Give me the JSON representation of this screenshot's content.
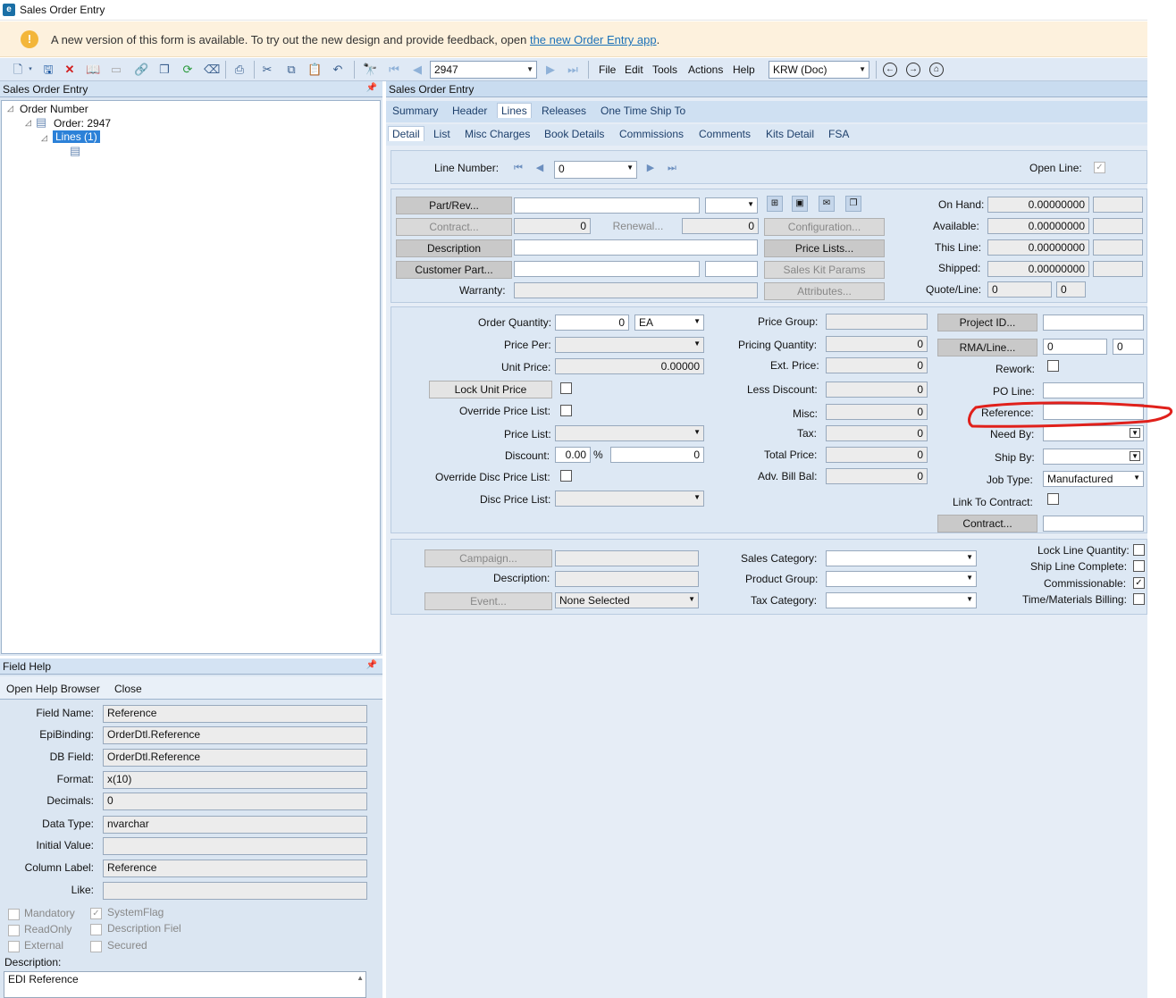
{
  "window": {
    "title": "Sales Order Entry"
  },
  "banner": {
    "text": "A new version of this form is available. To try out the new design and provide feedback, open ",
    "link": "the new Order Entry app",
    "tail": "."
  },
  "toolbar": {
    "order_value": "2947",
    "currency_value": "KRW (Doc)",
    "menus": [
      "File",
      "Edit",
      "Tools",
      "Actions",
      "Help"
    ]
  },
  "tree_pane": {
    "title": "Sales Order Entry",
    "root": "Order Number",
    "order": "Order: 2947",
    "lines": "Lines (1)"
  },
  "field_help": {
    "title": "Field Help",
    "open_browser": "Open Help Browser",
    "close": "Close",
    "rows": [
      {
        "label": "Field Name:",
        "value": "Reference"
      },
      {
        "label": "EpiBinding:",
        "value": "OrderDtl.Reference"
      },
      {
        "label": "DB Field:",
        "value": "OrderDtl.Reference"
      },
      {
        "label": "Format:",
        "value": "x(10)"
      },
      {
        "label": "Decimals:",
        "value": "0"
      },
      {
        "label": "Data Type:",
        "value": "nvarchar"
      },
      {
        "label": "Initial Value:",
        "value": ""
      },
      {
        "label": "Column Label:",
        "value": "Reference"
      },
      {
        "label": "Like:",
        "value": ""
      }
    ],
    "flags": {
      "mandatory": "Mandatory",
      "system": "SystemFlag",
      "readonly": "ReadOnly",
      "desc_field": "Description Fiel",
      "external": "External",
      "secured": "Secured"
    },
    "description_label": "Description:",
    "description_value": "EDI Reference"
  },
  "main": {
    "title": "Sales Order Entry",
    "tabs": [
      "Summary",
      "Header",
      "Lines",
      "Releases",
      "One Time Ship To"
    ],
    "subtabs": [
      "Detail",
      "List",
      "Misc Charges",
      "Book Details",
      "Commissions",
      "Comments",
      "Kits Detail",
      "FSA"
    ],
    "line_number_label": "Line Number:",
    "line_number_value": "0",
    "open_line_label": "Open Line:",
    "part": {
      "part_rev": "Part/Rev...",
      "contract": "Contract...",
      "contract_val": "0",
      "renewal": "Renewal...",
      "renewal_val": "0",
      "description": "Description",
      "customer_part": "Customer Part...",
      "warranty": "Warranty:",
      "configuration": "Configuration...",
      "price_lists": "Price Lists...",
      "sales_kit": "Sales Kit Params",
      "attributes": "Attributes..."
    },
    "stock": {
      "on_hand": "On Hand:",
      "on_hand_val": "0.00000000",
      "available": "Available:",
      "available_val": "0.00000000",
      "this_line": "This Line:",
      "this_line_val": "0.00000000",
      "shipped": "Shipped:",
      "shipped_val": "0.00000000",
      "quote_line": "Quote/Line:",
      "quote_val1": "0",
      "quote_val2": "0"
    },
    "pricing": {
      "order_qty": "Order Quantity:",
      "order_qty_val": "0",
      "uom": "EA",
      "price_per": "Price Per:",
      "unit_price": "Unit Price:",
      "unit_price_val": "0.00000",
      "lock_unit_price": "Lock Unit Price",
      "override_price_list": "Override Price List:",
      "price_list": "Price List:",
      "discount": "Discount:",
      "discount_pct": "0.00",
      "pct": "%",
      "discount_val": "0",
      "override_disc": "Override Disc Price List:",
      "disc_price_list": "Disc Price List:"
    },
    "totals": {
      "price_group": "Price Group:",
      "pricing_qty": "Pricing Quantity:",
      "pricing_qty_val": "0",
      "ext_price": "Ext. Price:",
      "ext_price_val": "0",
      "less_discount": "Less Discount:",
      "less_discount_val": "0",
      "misc": "Misc:",
      "misc_val": "0",
      "tax": "Tax:",
      "tax_val": "0",
      "total_price": "Total Price:",
      "total_price_val": "0",
      "adv_bill": "Adv. Bill Bal:",
      "adv_bill_val": "0"
    },
    "project": {
      "project_id": "Project ID...",
      "rma_line": "RMA/Line...",
      "rma_val1": "0",
      "rma_val2": "0",
      "rework": "Rework:",
      "po_line": "PO Line:",
      "reference": "Reference:",
      "need_by": "Need By:",
      "ship_by": "Ship By:",
      "job_type": "Job Type:",
      "job_type_val": "Manufactured",
      "link_contract": "Link To Contract:",
      "contract_btn": "Contract..."
    },
    "category": {
      "campaign": "Campaign...",
      "description": "Description:",
      "event": "Event...",
      "event_val": "None Selected",
      "sales_category": "Sales Category:",
      "product_group": "Product Group:",
      "tax_category": "Tax Category:",
      "lock_line_qty": "Lock Line Quantity:",
      "ship_line_complete": "Ship Line Complete:",
      "commissionable": "Commissionable:",
      "time_materials": "Time/Materials Billing:"
    }
  },
  "colors": {
    "annotation": "#e0201b",
    "banner": "#fdf1dd",
    "tab_bg": "#cfe0f2"
  }
}
